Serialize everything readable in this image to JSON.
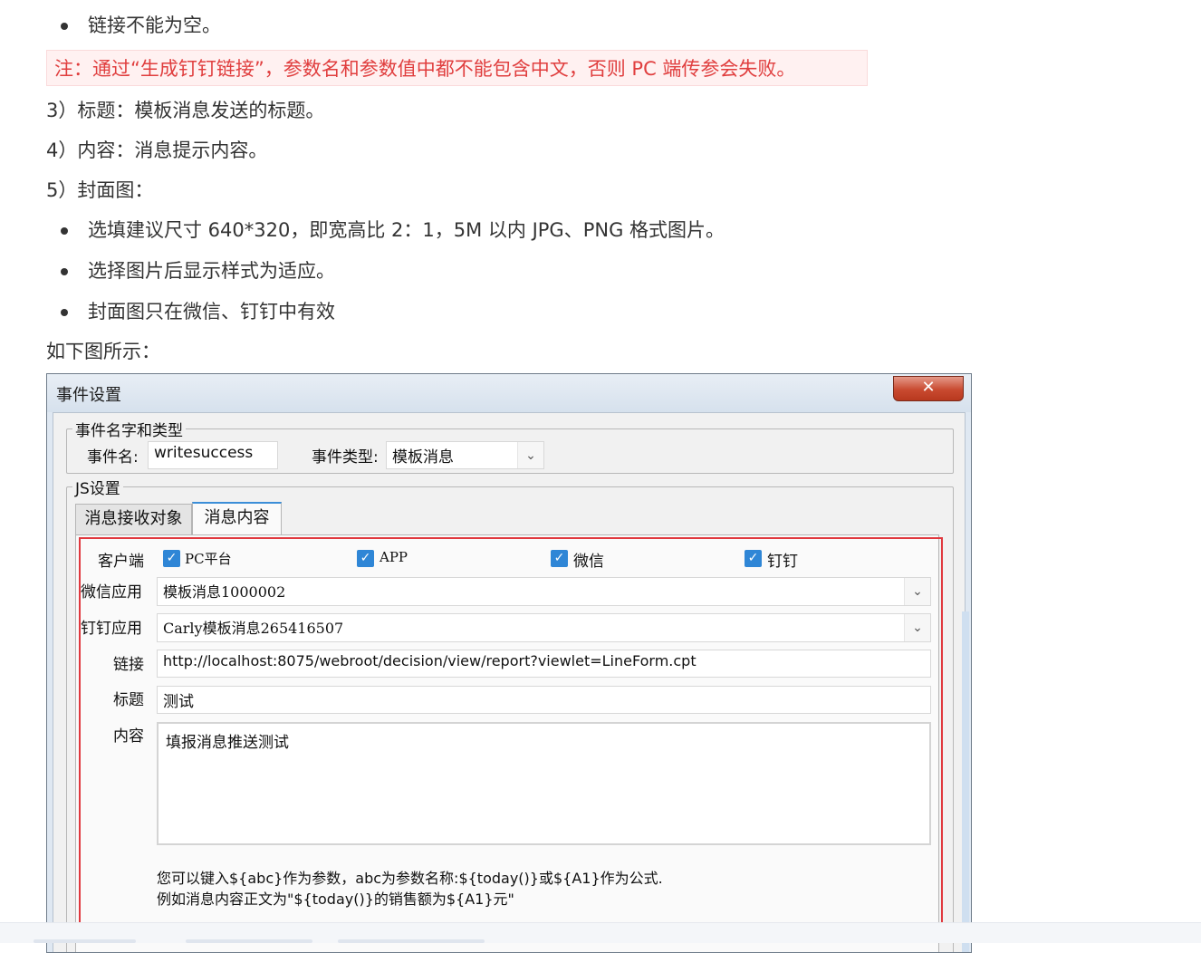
{
  "doc": {
    "bullet_link_empty": "链接不能为空。",
    "note": "注：通过“生成钉钉链接”，参数名和参数值中都不能包含中文，否则 PC 端传参会失败。",
    "item3": "3）标题：模板消息发送的标题。",
    "item4": "4）内容：消息提示内容。",
    "item5": "5）封面图：",
    "cover_bullets": [
      "选填建议尺寸 640*320，即宽高比 2：1，5M 以内 JPG、PNG 格式图片。",
      "选择图片后显示样式为适应。",
      "封面图只在微信、钉钉中有效"
    ],
    "figure_intro": "如下图所示："
  },
  "dialog": {
    "title": "事件设置",
    "close_glyph": "✕",
    "group_name_type": "事件名字和类型",
    "event_name_label": "事件名:",
    "event_name_value": "writesuccess",
    "event_type_label": "事件类型:",
    "event_type_value": "模板消息",
    "group_js": "JS设置",
    "tabs": [
      "消息接收对象",
      "消息内容"
    ],
    "client_label": "客户端",
    "clients": [
      "PC平台",
      "APP",
      "微信",
      "钉钉"
    ],
    "wechat_app_label": "微信应用",
    "wechat_app_value": "模板消息1000002",
    "dingtalk_app_label": "钉钉应用",
    "dingtalk_app_value": "Carly模板消息265416507",
    "link_label": "链接",
    "link_value": "http://localhost:8075/webroot/decision/view/report?viewlet=LineForm.cpt",
    "title_label": "标题",
    "title_value": "测试",
    "content_label": "内容",
    "content_value": "填报消息推送测试",
    "hint_line1": "您可以键入${abc}作为参数，abc为参数名称:${today()}或${A1}作为公式.",
    "hint_line2": "例如消息内容正文为\"${today()}的销售额为${A1}元\""
  },
  "colors": {
    "note_text": "#e03e3e",
    "checkbox": "#2f86d6",
    "highlight_frame": "#e0383e",
    "active_tab": "#3b8ed8"
  }
}
